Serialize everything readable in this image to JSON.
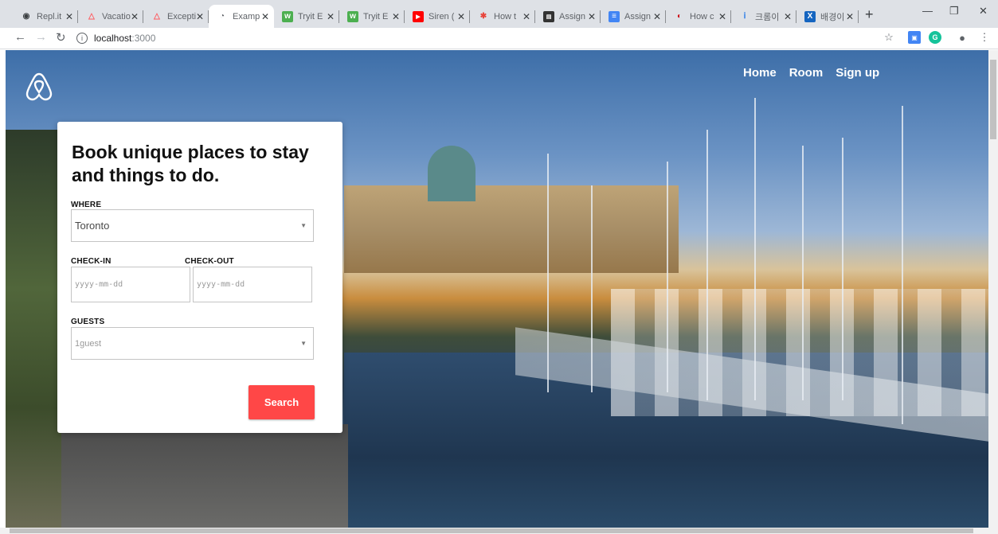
{
  "browser": {
    "tabs": [
      {
        "title": "Repl.it",
        "icon": "replit-icon"
      },
      {
        "title": "Vacatio",
        "icon": "airbnb-icon"
      },
      {
        "title": "Excepti",
        "icon": "airbnb-icon"
      },
      {
        "title": "Examp",
        "icon": "globe-icon",
        "active": true
      },
      {
        "title": "Tryit E",
        "icon": "w3schools-icon"
      },
      {
        "title": "Tryit E",
        "icon": "w3schools-icon"
      },
      {
        "title": "Siren (",
        "icon": "youtube-icon"
      },
      {
        "title": "How t",
        "icon": "puzzle-icon"
      },
      {
        "title": "Assign",
        "icon": "assignment-icon"
      },
      {
        "title": "Assign",
        "icon": "docs-icon"
      },
      {
        "title": "How c",
        "icon": "opera-icon"
      },
      {
        "title": "크롬이",
        "icon": "info-icon"
      },
      {
        "title": "배경이",
        "icon": "x-icon"
      }
    ],
    "new_tab": "+",
    "url_host": "localhost",
    "url_port": ":3000"
  },
  "site": {
    "nav": [
      "Home",
      "Room",
      "Sign up"
    ],
    "accent": "#ff4747"
  },
  "booking": {
    "heading": "Book unique places to stay and things to do.",
    "where_label": "WHERE",
    "where_value": "Toronto",
    "checkin_label": "CHECK-IN",
    "checkout_label": "CHECK-OUT",
    "checkin_placeholder": "yyyy-mm-dd",
    "checkout_placeholder": "yyyy-mm-dd",
    "guests_label": "GUESTS",
    "guests_value": "1guest",
    "search_label": "Search"
  }
}
